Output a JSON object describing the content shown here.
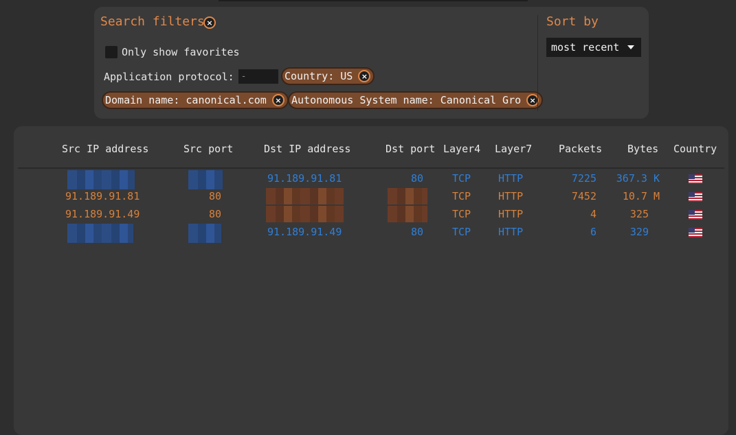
{
  "filters": {
    "title": "Search filters",
    "favorites_label": "Only show favorites",
    "app_protocol_label": "Application protocol:",
    "app_protocol_placeholder": "-",
    "chips": {
      "country": "Country: US",
      "domain": "Domain name: canonical.com",
      "asn": "Autonomous System name: Canonical Gro"
    },
    "clear_glyph": "×"
  },
  "sort": {
    "title": "Sort by",
    "selected": "most recent"
  },
  "table": {
    "headers": [
      "Src IP address",
      "Src port",
      "Dst IP address",
      "Dst port",
      "Layer4",
      "Layer7",
      "Packets",
      "Bytes",
      "Country"
    ],
    "rows": [
      {
        "src_ip": "",
        "src_port": "",
        "dst_ip": "91.189.91.81",
        "dst_port": "80",
        "l4": "TCP",
        "l7": "HTTP",
        "packets": "7225",
        "bytes": "367.3 K",
        "direction": "out",
        "country": "US"
      },
      {
        "src_ip": "91.189.91.81",
        "src_port": "80",
        "dst_ip": "",
        "dst_port": "",
        "l4": "TCP",
        "l7": "HTTP",
        "packets": "7452",
        "bytes": "10.7 M",
        "direction": "in",
        "country": "US"
      },
      {
        "src_ip": "91.189.91.49",
        "src_port": "80",
        "dst_ip": "",
        "dst_port": "",
        "l4": "TCP",
        "l7": "HTTP",
        "packets": "4",
        "bytes": "325",
        "direction": "in",
        "country": "US"
      },
      {
        "src_ip": "",
        "src_port": "",
        "dst_ip": "91.189.91.49",
        "dst_port": "80",
        "l4": "TCP",
        "l7": "HTTP",
        "packets": "6",
        "bytes": "329",
        "direction": "out",
        "country": "US"
      }
    ]
  },
  "colors": {
    "accent": "#e0884a",
    "outgoing": "#2f7fd8",
    "incoming": "#d8823c"
  }
}
